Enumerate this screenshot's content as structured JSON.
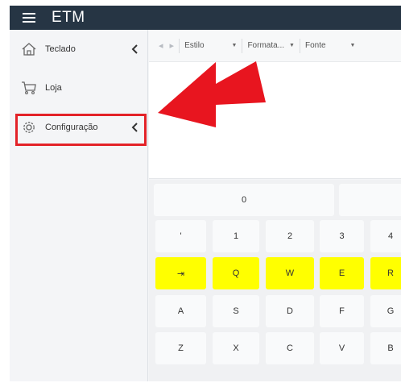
{
  "app": {
    "title": "ETM"
  },
  "sidebar": {
    "items": [
      {
        "label": "Teclado",
        "icon": "home-icon"
      },
      {
        "label": "Loja",
        "icon": "cart-icon"
      },
      {
        "label": "Configuração",
        "icon": "gear-icon"
      }
    ]
  },
  "editor": {
    "toolbar": {
      "undo_icon": "undo-icon",
      "redo_icon": "redo-icon",
      "style": "Estilo",
      "format": "Formata...",
      "font": "Fonte"
    }
  },
  "keyboard": {
    "row0": [
      "0",
      ""
    ],
    "row1": [
      "'",
      "1",
      "2",
      "3",
      "4"
    ],
    "row2": [
      "⇥",
      "Q",
      "W",
      "E",
      "R"
    ],
    "row3": [
      "A",
      "S",
      "D",
      "F",
      "G"
    ],
    "row4": [
      "Z",
      "X",
      "C",
      "V",
      "B"
    ]
  },
  "colors": {
    "topbar": "#263544",
    "highlight": "#e32228",
    "key_highlight": "#ffff00",
    "arrow": "#e8151f"
  }
}
